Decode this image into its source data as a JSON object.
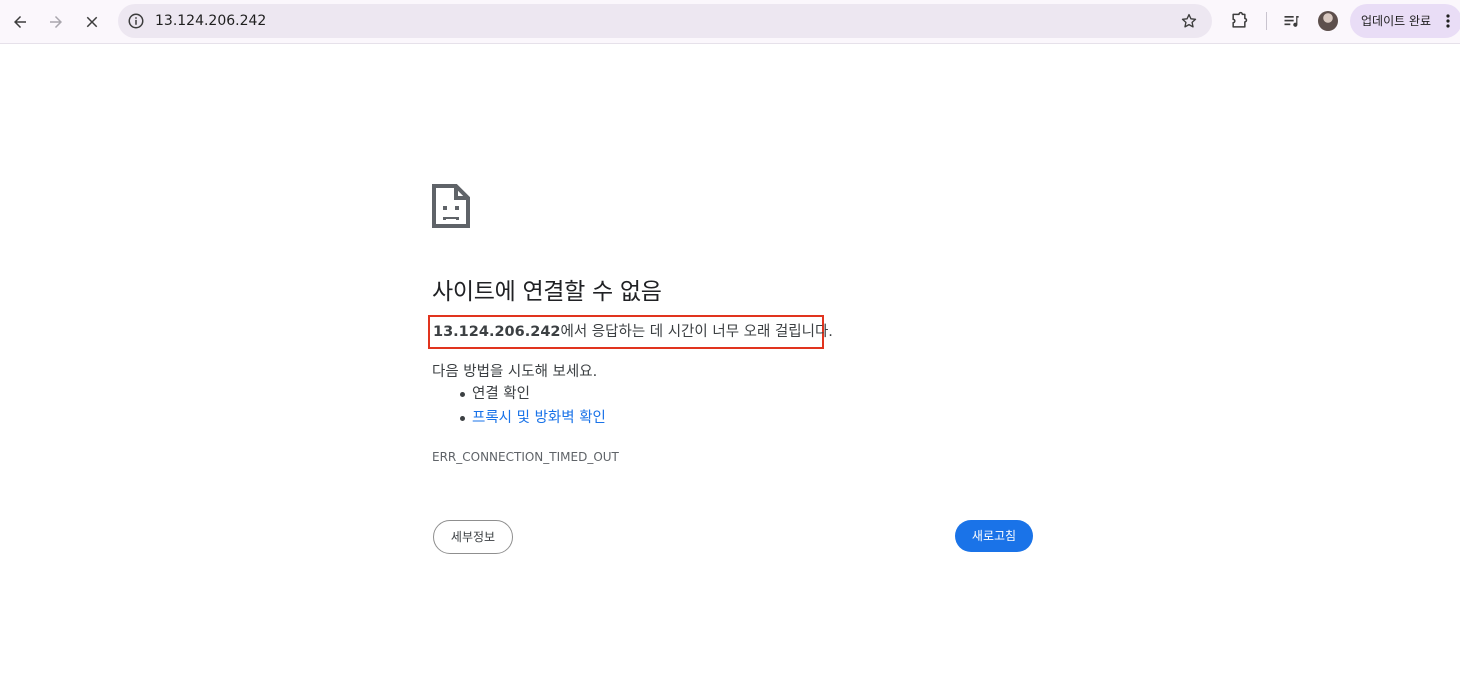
{
  "toolbar": {
    "url": "13.124.206.242",
    "update_chip_label": "업데이트 완료",
    "icons": [
      "back-arrow-icon",
      "forward-arrow-icon",
      "stop-icon",
      "info-icon",
      "star-icon",
      "extensions-icon",
      "reading-list-icon",
      "profile-avatar",
      "more-vert-icon"
    ]
  },
  "error_page": {
    "icon": "sad-page-icon",
    "heading": "사이트에 연결할 수 없음",
    "summary_host": "13.124.206.242",
    "summary_rest": "에서 응답하는 데 시간이 너무 오래 걸립니다.",
    "suggestion_intro": "다음 방법을 시도해 보세요.",
    "suggestions": [
      {
        "label": "연결 확인",
        "link": false
      },
      {
        "label": "프록시 및 방화벽 확인",
        "link": true
      }
    ],
    "error_code": "ERR_CONNECTION_TIMED_OUT",
    "details_button": "세부정보",
    "reload_button": "새로고침"
  },
  "colors": {
    "accent": "#1a73e8",
    "highlight_box": "#e1341e",
    "toolbar_bg": "#fbf7fc",
    "omnibox_bg": "#ede7f1",
    "chip_bg": "#e9ddf6"
  }
}
